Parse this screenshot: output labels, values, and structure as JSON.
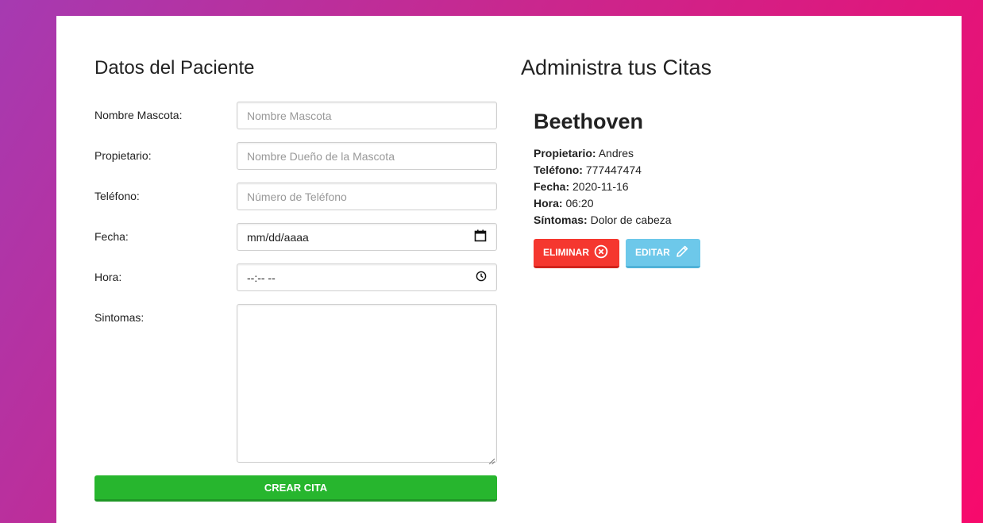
{
  "form": {
    "title": "Datos del Paciente",
    "fields": [
      {
        "label": "Nombre Mascota:",
        "placeholder": "Nombre Mascota"
      },
      {
        "label": "Propietario:",
        "placeholder": "Nombre Dueño de la Mascota"
      },
      {
        "label": "Teléfono:",
        "placeholder": "Número de Teléfono"
      },
      {
        "label": "Fecha:",
        "placeholder": "mm/dd/aaaa",
        "icon": "calendar-icon"
      },
      {
        "label": "Hora:",
        "placeholder": "--:-- --",
        "icon": "clock-icon"
      },
      {
        "label": "Sintomas:",
        "value": ""
      }
    ],
    "submit_label": "CREAR CITA"
  },
  "list": {
    "title": "Administra tus Citas",
    "citas": [
      {
        "mascota": "Beethoven",
        "propietario_label": "Propietario:",
        "propietario": "Andres",
        "telefono_label": "Teléfono:",
        "telefono": "777447474",
        "fecha_label": "Fecha:",
        "fecha": "2020-11-16",
        "hora_label": "Hora:",
        "hora": "06:20",
        "sintomas_label": "Síntomas:",
        "sintomas": "Dolor de cabeza",
        "delete_label": "ELIMINAR",
        "edit_label": "EDITAR"
      }
    ]
  },
  "colors": {
    "submit": "#27b62e",
    "delete": "#f5372f",
    "edit": "#6dc8ea"
  }
}
